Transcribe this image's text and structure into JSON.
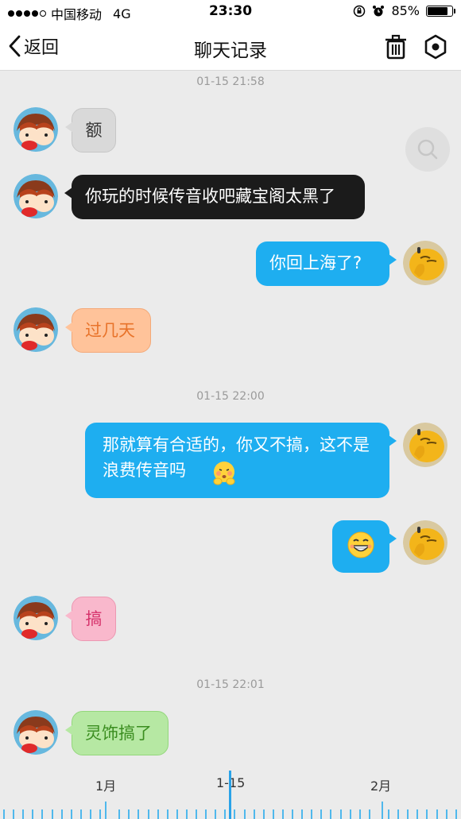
{
  "status": {
    "carrier": "中国移动",
    "network": "4G",
    "time": "23:30",
    "battery": "85%",
    "battery_level": 0.85
  },
  "nav": {
    "back_label": "返回",
    "title": "聊天记录"
  },
  "timestamps": [
    "01-15 21:58",
    "01-15 22:00",
    "01-15 22:01"
  ],
  "messages": [
    {
      "side": "left",
      "text": "额",
      "style": "gray"
    },
    {
      "side": "left",
      "text": "你玩的时候传音收吧藏宝阁太黑了",
      "style": "black"
    },
    {
      "side": "right",
      "text": "你回上海了?",
      "style": "blue"
    },
    {
      "side": "left",
      "text": "过几天",
      "style": "orange"
    },
    {
      "side": "right",
      "text": "那就算有合适的，你又不搞，这不是浪费传音吗",
      "style": "blue",
      "emoji": "blush-emoji"
    },
    {
      "side": "right",
      "text": "",
      "style": "blue",
      "emoji": "grin-emoji"
    },
    {
      "side": "left",
      "text": "搞",
      "style": "pink"
    },
    {
      "side": "left",
      "text": "灵饰搞了",
      "style": "green"
    }
  ],
  "timeline": {
    "labels": [
      "1月",
      "1-15",
      "2月"
    ]
  },
  "colors": {
    "accent": "#1eaef0",
    "gray_bubble": "#d9d9d9",
    "black_bubble": "#1b1b1b",
    "orange_bubble": "#ffc39a",
    "pink_bubble": "#f9b8cc",
    "green_bubble": "#b6e8a3"
  }
}
